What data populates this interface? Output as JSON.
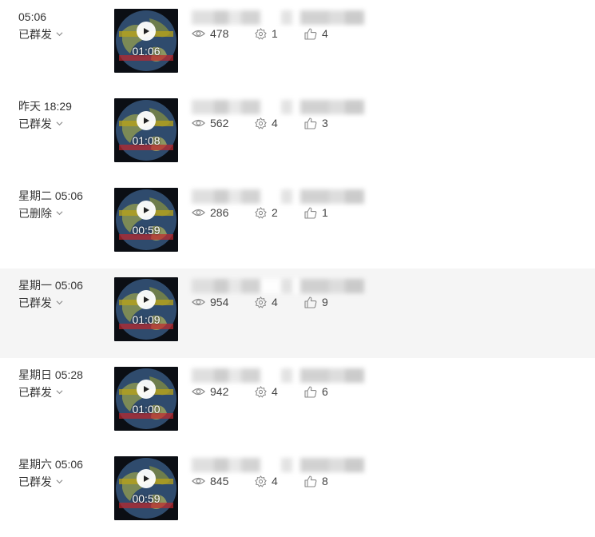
{
  "rows": [
    {
      "time": "05:06",
      "status": "已群发",
      "duration": "01:06",
      "views": "478",
      "shares": "1",
      "likes": "4",
      "highlight": false
    },
    {
      "time": "昨天 18:29",
      "status": "已群发",
      "duration": "01:08",
      "views": "562",
      "shares": "4",
      "likes": "3",
      "highlight": false
    },
    {
      "time": "星期二 05:06",
      "status": "已删除",
      "duration": "00:59",
      "views": "286",
      "shares": "2",
      "likes": "1",
      "highlight": false
    },
    {
      "time": "星期一 05:06",
      "status": "已群发",
      "duration": "01:09",
      "views": "954",
      "shares": "4",
      "likes": "9",
      "highlight": true
    },
    {
      "time": "星期日 05:28",
      "status": "已群发",
      "duration": "01:00",
      "views": "942",
      "shares": "4",
      "likes": "6",
      "highlight": false
    },
    {
      "time": "星期六 05:06",
      "status": "已群发",
      "duration": "00:59",
      "views": "845",
      "shares": "4",
      "likes": "8",
      "highlight": false
    }
  ],
  "icons": {
    "views": "eye-icon",
    "shares": "share-gear-icon",
    "likes": "thumbs-up-icon",
    "status_toggle": "chevron-down-icon",
    "play": "play-icon"
  },
  "colors": {
    "row_highlight": "#f5f5f5",
    "icon": "#8a8a8a",
    "text": "#353535"
  }
}
